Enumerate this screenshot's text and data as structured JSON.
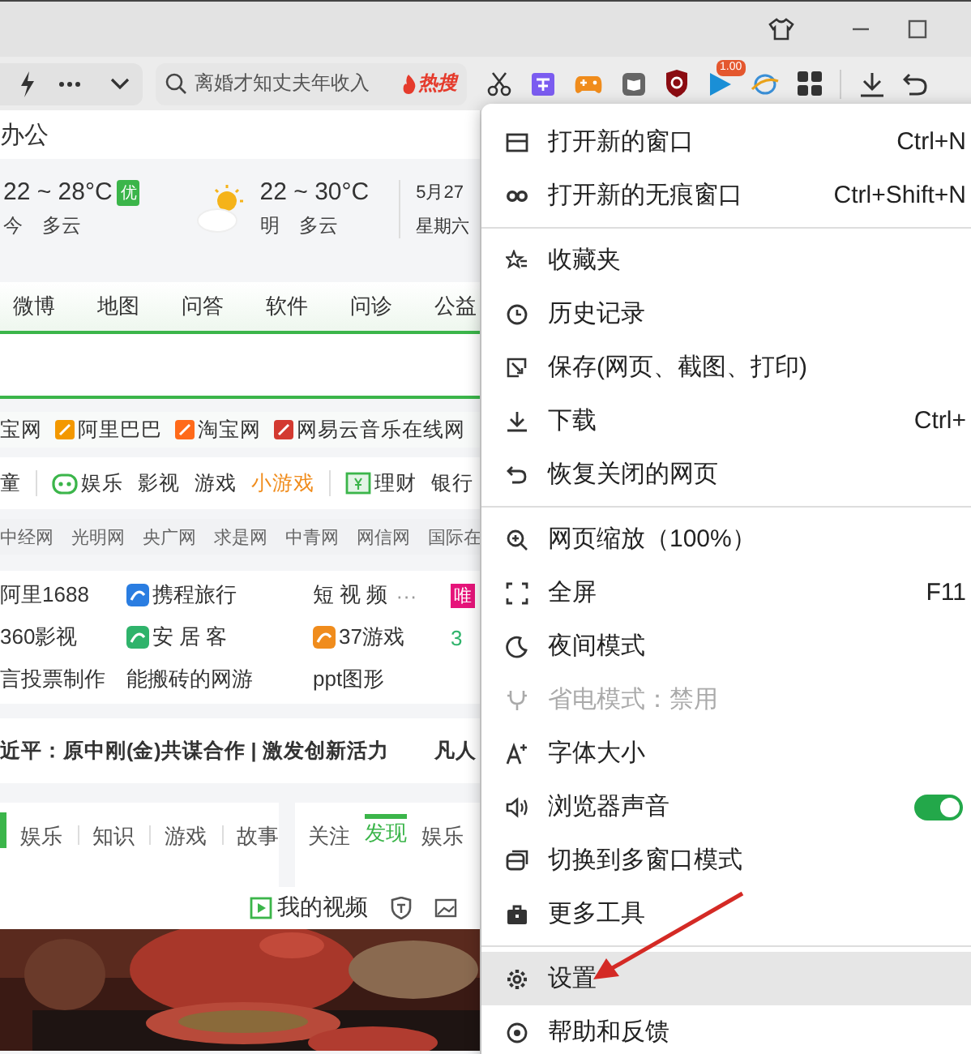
{
  "toolbar": {
    "search": {
      "value": "离婚才知丈夫年收入",
      "hot_label": "热搜"
    },
    "extension_badge": "1.00"
  },
  "page": {
    "heading": "办公",
    "weather": [
      {
        "temp": "22 ~ 28°C",
        "air_quality": "优",
        "day": "今",
        "condition": "多云"
      },
      {
        "temp": "22 ~ 30°C",
        "day": "明",
        "condition": "多云"
      }
    ],
    "date": "5月27",
    "weekday": "星期六",
    "nav_links": [
      "微博",
      "地图",
      "问答",
      "软件",
      "问诊",
      "公益"
    ],
    "site_links": [
      {
        "label": "宝网",
        "kind": "plain"
      },
      {
        "label": "阿里巴巴",
        "kind": "icon",
        "color": "#f39800"
      },
      {
        "label": "淘宝网",
        "kind": "icon",
        "color": "#ff6a1a"
      },
      {
        "label": "网易云音乐在线网",
        "kind": "icon",
        "color": "#d33a31"
      }
    ],
    "categories": [
      {
        "label": "童",
        "kind": "plain"
      },
      {
        "label": "娱乐",
        "kind": "icon"
      },
      {
        "label": "影视",
        "kind": "plain"
      },
      {
        "label": "游戏",
        "kind": "plain"
      },
      {
        "label": "小游戏",
        "kind": "highlight"
      },
      {
        "label": "理财",
        "kind": "icon"
      },
      {
        "label": "银行",
        "kind": "plain"
      }
    ],
    "news_sites": [
      "中经网",
      "光明网",
      "央广网",
      "求是网",
      "中青网",
      "网信网",
      "国际在"
    ],
    "quick_links": [
      [
        {
          "label": "阿里1688",
          "kind": "plain"
        },
        {
          "label": "携程旅行",
          "kind": "icon",
          "color": "#2a7de1"
        },
        {
          "label": "短 视 频",
          "kind": "more"
        },
        {
          "label": "唯",
          "kind": "logo",
          "color": "#e6147a"
        }
      ],
      [
        {
          "label": "360影视",
          "kind": "plain"
        },
        {
          "label": "安 居 客",
          "kind": "icon",
          "color": "#2fb36b"
        },
        {
          "label": "37游戏",
          "kind": "icon",
          "color": "#f08c1c"
        },
        {
          "label": "3",
          "kind": "accent"
        }
      ],
      [
        {
          "label": "言投票制作",
          "kind": "plain"
        },
        {
          "label": "能搬砖的网游",
          "kind": "plain"
        },
        {
          "label": "ppt图形",
          "kind": "plain"
        }
      ]
    ],
    "more_mark": "···",
    "headline": "近平：原中刚(金)共谋合作 | 激发创新活力",
    "headline_2": "凡人",
    "feed_tabs": [
      {
        "label": "娱乐",
        "selected": false
      },
      {
        "label": "知识",
        "selected": false
      },
      {
        "label": "游戏",
        "selected": false
      },
      {
        "label": "故事",
        "selected": false
      }
    ],
    "side_tabs": [
      {
        "label": "关注",
        "selected": false
      },
      {
        "label": "发现",
        "selected": true
      },
      {
        "label": "娱乐",
        "selected": false
      }
    ],
    "video_bar": {
      "label": "我的视频"
    }
  },
  "menu": {
    "groups": [
      [
        {
          "label": "打开新的窗口",
          "shortcut": "Ctrl+N",
          "kind": "item",
          "disabled": false,
          "selected": false
        },
        {
          "label": "打开新的无痕窗口",
          "shortcut": "Ctrl+Shift+N",
          "kind": "item",
          "disabled": false,
          "selected": false
        }
      ],
      [
        {
          "label": "收藏夹",
          "kind": "item",
          "disabled": false,
          "selected": false
        },
        {
          "label": "历史记录",
          "kind": "item",
          "disabled": false,
          "selected": false
        },
        {
          "label": "保存(网页、截图、打印)",
          "kind": "item",
          "disabled": false,
          "selected": false
        },
        {
          "label": "下载",
          "shortcut": "Ctrl+",
          "kind": "item",
          "disabled": false,
          "selected": false
        },
        {
          "label": "恢复关闭的网页",
          "kind": "item",
          "disabled": false,
          "selected": false
        }
      ],
      [
        {
          "label": "网页缩放（100%）",
          "kind": "item",
          "disabled": false,
          "selected": false
        },
        {
          "label": "全屏",
          "shortcut": "F11",
          "kind": "item",
          "disabled": false,
          "selected": false
        },
        {
          "label": "夜间模式",
          "kind": "item",
          "disabled": false,
          "selected": false
        },
        {
          "label": "省电模式：禁用",
          "kind": "item",
          "disabled": true,
          "selected": false
        },
        {
          "label": "字体大小",
          "kind": "item",
          "disabled": false,
          "selected": false
        },
        {
          "label": "浏览器声音",
          "kind": "toggle",
          "on": true,
          "disabled": false,
          "selected": false
        },
        {
          "label": "切换到多窗口模式",
          "kind": "item",
          "disabled": false,
          "selected": false
        },
        {
          "label": "更多工具",
          "kind": "item",
          "disabled": false,
          "selected": false
        }
      ],
      [
        {
          "label": "设置",
          "kind": "item",
          "disabled": false,
          "selected": true
        },
        {
          "label": "帮助和反馈",
          "kind": "item",
          "disabled": false,
          "selected": false
        }
      ]
    ]
  }
}
